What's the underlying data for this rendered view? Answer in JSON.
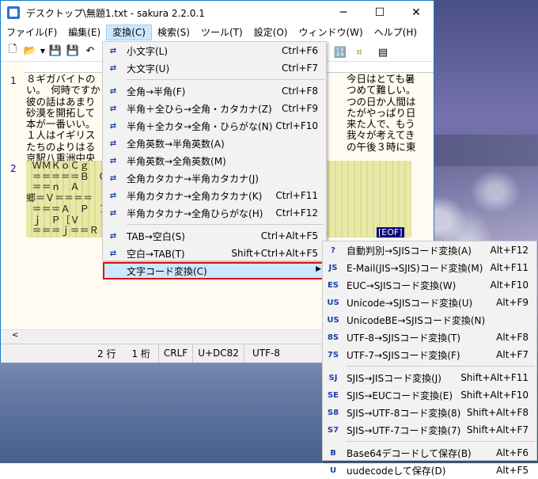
{
  "window": {
    "title": "デスクトップ\\無題1.txt - sakura 2.2.0.1",
    "minimize": "─",
    "maximize": "☐",
    "close": "✕"
  },
  "menubar": [
    {
      "label": "ファイル(F)"
    },
    {
      "label": "編集(E)"
    },
    {
      "label": "変換(C)"
    },
    {
      "label": "検索(S)"
    },
    {
      "label": "ツール(T)"
    },
    {
      "label": "設定(O)"
    },
    {
      "label": "ウィンドウ(W)"
    },
    {
      "label": "ヘルプ(H)"
    }
  ],
  "editor": {
    "line1": "1",
    "line2": "2",
    "text_lines": "８ギガバイトの\nい。　何時ですか\n彼の話はあまり\n砂漠を開拓して\n本が一番いい。\n１人はイギリス\nたちのよりはる\n京駅八重洲中央",
    "text_right": "今日はとても暑\nつめて難しい。\nつの日か人間は\nたがやっぱり日\n来た人で、もう\n我々が考えてき\nの午後３時に東",
    "garbled_lines": "  ＷＭＫｏＣｇ\n  ＝＝＝＝＝Ｂ　Ｑ\n  ＝＝ｎ　Ａ\n郷＝Ｖ＝＝＝＝\n  ＝＝＝Ａ　Ｐ　Ｉ\n  ｊ　Ｐ［Ｖ\n  ＝＝＝ｊ＝＝Ｒ",
    "eof": "[EOF]"
  },
  "statusbar": {
    "row": "2 行",
    "col": "1 桁",
    "eol": "CRLF",
    "char": "U+DC82",
    "encoding": "UTF-8"
  },
  "convert_menu": [
    {
      "label": "小文字(L)",
      "shortcut": "Ctrl+F6",
      "icon": "lowercase-icon"
    },
    {
      "label": "大文字(U)",
      "shortcut": "Ctrl+F7",
      "icon": "uppercase-icon"
    },
    {
      "sep": true
    },
    {
      "label": "全角→半角(F)",
      "shortcut": "Ctrl+F8",
      "icon": "zen-to-han-icon"
    },
    {
      "label": "半角＋全ひら→全角・カタカナ(Z)",
      "shortcut": "Ctrl+F9",
      "icon": "hira-to-kata-icon"
    },
    {
      "label": "半角＋全カタ→全角・ひらがな(N)",
      "shortcut": "Ctrl+F10",
      "icon": "kata-to-hira-icon"
    },
    {
      "label": "全角英数→半角英数(A)",
      "shortcut": "",
      "icon": "alnum-to-han-icon"
    },
    {
      "label": "半角英数→全角英数(M)",
      "shortcut": "",
      "icon": "alnum-to-zen-icon"
    },
    {
      "label": "全角カタカナ→半角カタカナ(J)",
      "shortcut": "",
      "icon": "kata-zen-to-han-icon"
    },
    {
      "label": "半角カタカナ→全角カタカナ(K)",
      "shortcut": "Ctrl+F11",
      "icon": "kata-han-to-zen-icon"
    },
    {
      "label": "半角カタカナ→全角ひらがな(H)",
      "shortcut": "Ctrl+F12",
      "icon": "kata-han-to-hira-icon"
    },
    {
      "sep": true
    },
    {
      "label": "TAB→空白(S)",
      "shortcut": "Ctrl+Alt+F5",
      "icon": "tab-to-space-icon"
    },
    {
      "label": "空白→TAB(T)",
      "shortcut": "Shift+Ctrl+Alt+F5",
      "icon": "space-to-tab-icon"
    },
    {
      "label": "文字コード変換(C)",
      "shortcut": "",
      "icon": "",
      "submenu": true
    }
  ],
  "charcode_menu": [
    {
      "label": "自動判別→SJISコード変換(A)",
      "shortcut": "Alt+F12",
      "icon": "auto-to-sjis-icon",
      "tag": "?"
    },
    {
      "label": "E-Mail(JIS→SJIS)コード変換(M)",
      "shortcut": "Alt+F11",
      "icon": "email-to-sjis-icon",
      "tag": "JS"
    },
    {
      "label": "EUC→SJISコード変換(W)",
      "shortcut": "Alt+F10",
      "icon": "euc-to-sjis-icon",
      "tag": "ES"
    },
    {
      "label": "Unicode→SJISコード変換(U)",
      "shortcut": "Alt+F9",
      "icon": "unicode-to-sjis-icon",
      "tag": "US"
    },
    {
      "label": "UnicodeBE→SJISコード変換(N)",
      "shortcut": "",
      "icon": "unicodebe-to-sjis-icon",
      "tag": "US"
    },
    {
      "label": "UTF-8→SJISコード変換(T)",
      "shortcut": "Alt+F8",
      "icon": "utf8-to-sjis-icon",
      "tag": "8S"
    },
    {
      "label": "UTF-7→SJISコード変換(F)",
      "shortcut": "Alt+F7",
      "icon": "utf7-to-sjis-icon",
      "tag": "7S"
    },
    {
      "sep": true
    },
    {
      "label": "SJIS→JISコード変換(J)",
      "shortcut": "Shift+Alt+F11",
      "icon": "sjis-to-jis-icon",
      "tag": "SJ"
    },
    {
      "label": "SJIS→EUCコード変換(E)",
      "shortcut": "Shift+Alt+F10",
      "icon": "sjis-to-euc-icon",
      "tag": "SE"
    },
    {
      "label": "SJIS→UTF-8コード変換(8)",
      "shortcut": "Shift+Alt+F8",
      "icon": "sjis-to-utf8-icon",
      "tag": "S8"
    },
    {
      "label": "SJIS→UTF-7コード変換(7)",
      "shortcut": "Shift+Alt+F7",
      "icon": "sjis-to-utf7-icon",
      "tag": "S7"
    },
    {
      "sep": true
    },
    {
      "label": "Base64デコードして保存(B)",
      "shortcut": "Alt+F6",
      "icon": "base64-save-icon",
      "tag": "B"
    },
    {
      "label": "uudecodeして保存(D)",
      "shortcut": "Alt+F5",
      "icon": "uudecode-save-icon",
      "tag": "U"
    }
  ],
  "colors": {
    "accent": "#cce8ff",
    "highlight_border": "#e01010"
  }
}
